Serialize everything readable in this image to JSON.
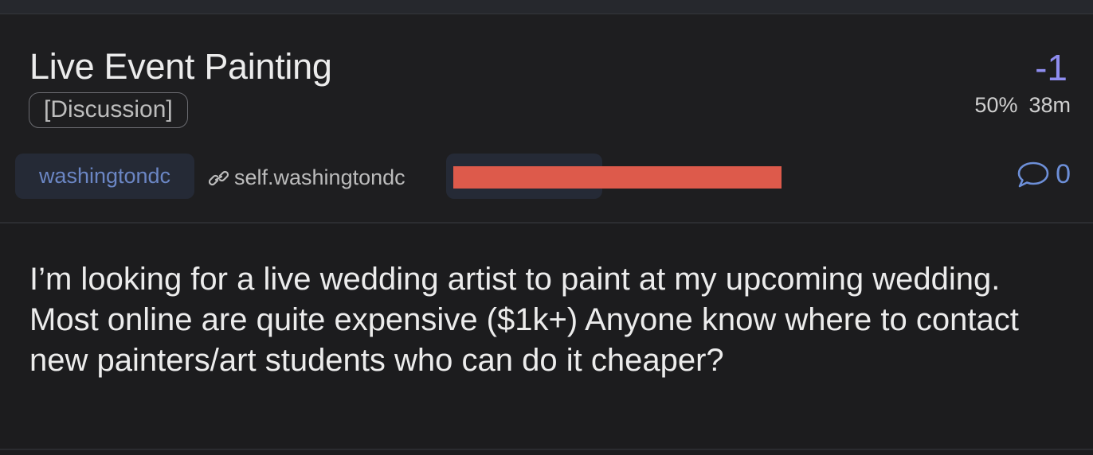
{
  "post": {
    "title": "Live Event Painting",
    "flair": "[Discussion]",
    "score": "-1",
    "upvote_ratio": "50%",
    "age": "38m",
    "community": "washingtondc",
    "domain": "self.washingtondc",
    "comment_count": "0",
    "body": "I’m looking for a live wedding artist to paint at my upcoming wedding. Most online are quite expensive ($1k+) Anyone know where to contact new painters/art students who can do it cheaper?"
  },
  "icons": {
    "domain": "link-icon",
    "comments": "comment-bubble-icon"
  },
  "colors": {
    "background": "#1c1c1e",
    "score": "#8f8df0",
    "community": "#6b86c4",
    "comments": "#6d8fd8",
    "redaction": "#dd5a4b"
  }
}
